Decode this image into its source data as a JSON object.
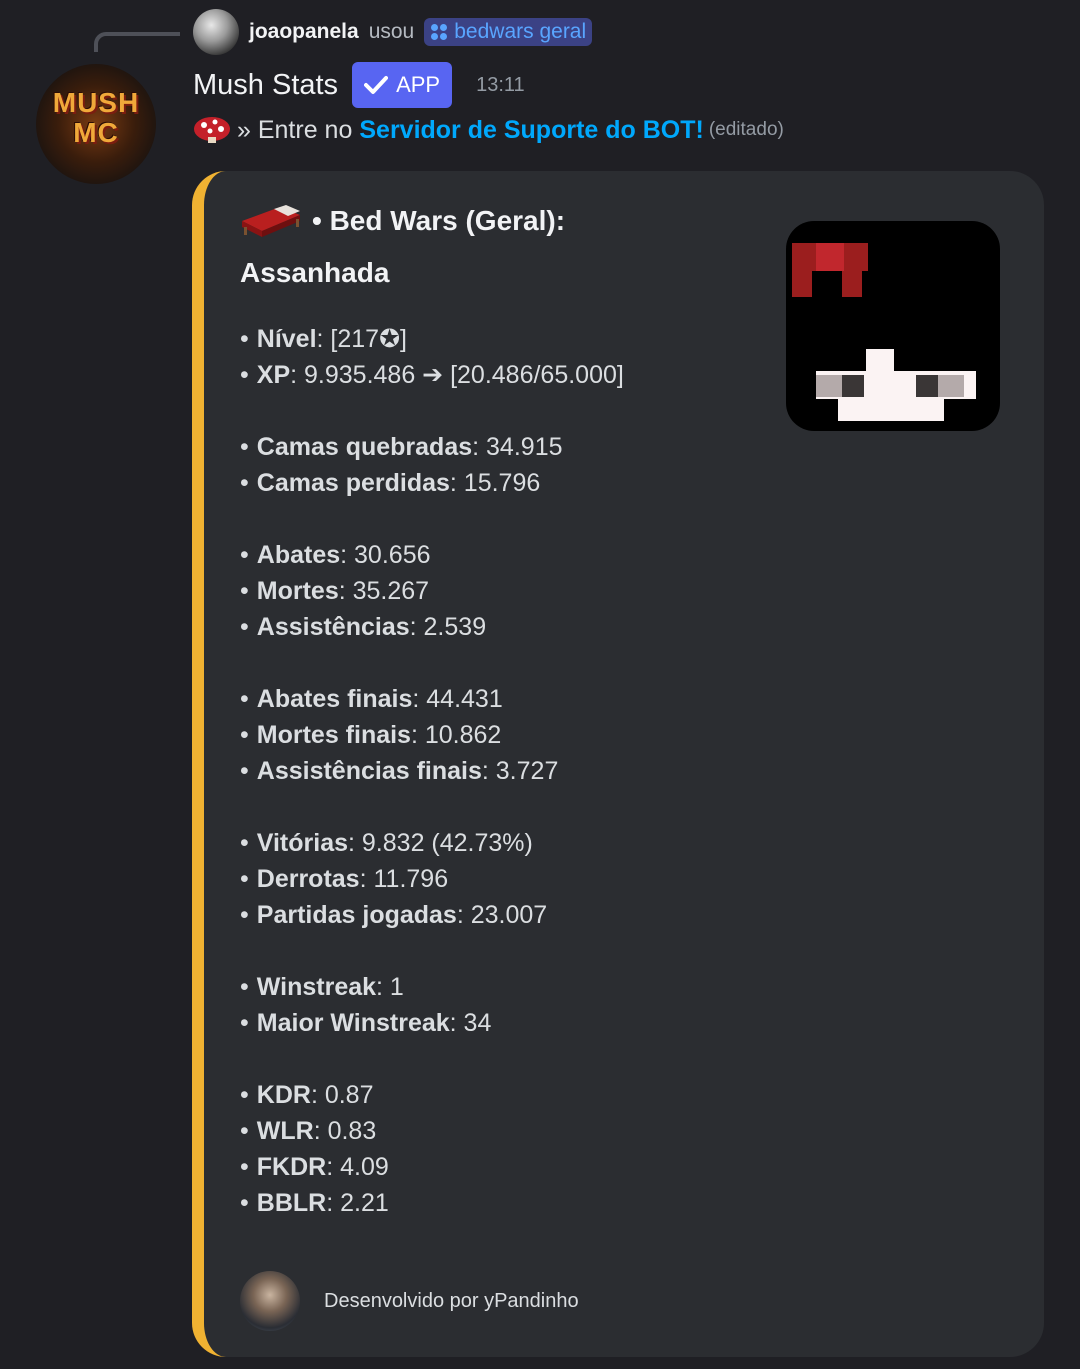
{
  "reply": {
    "username": "joaopanela",
    "action": "usou",
    "command": "bedwars geral"
  },
  "message": {
    "bot_name": "Mush Stats",
    "badge": "APP",
    "time": "13:11",
    "content_prefix": "» Entre no",
    "content_link": "Servidor de Suporte do BOT!",
    "edited": "(editado)"
  },
  "embed": {
    "accent_color": "#f0b232",
    "title": "• Bed Wars (Geral):",
    "subtitle": "Assanhada",
    "groups": [
      [
        {
          "label": "Nível",
          "value": ": [217✪]"
        },
        {
          "label": "XP",
          "value": ": 9.935.486 ➔ [20.486/65.000]"
        }
      ],
      [
        {
          "label": "Camas quebradas",
          "value": ": 34.915"
        },
        {
          "label": "Camas perdidas",
          "value": ": 15.796"
        }
      ],
      [
        {
          "label": "Abates",
          "value": ": 30.656"
        },
        {
          "label": "Mortes",
          "value": ": 35.267"
        },
        {
          "label": "Assistências",
          "value": ": 2.539"
        }
      ],
      [
        {
          "label": "Abates finais",
          "value": ": 44.431"
        },
        {
          "label": "Mortes finais",
          "value": ": 10.862"
        },
        {
          "label": "Assistências finais",
          "value": ": 3.727"
        }
      ],
      [
        {
          "label": "Vitórias",
          "value": ": 9.832 (42.73%)"
        },
        {
          "label": "Derrotas",
          "value": ": 11.796"
        },
        {
          "label": "Partidas jogadas",
          "value": ": 23.007"
        }
      ],
      [
        {
          "label": "Winstreak",
          "value": ": 1"
        },
        {
          "label": "Maior Winstreak",
          "value": ": 34"
        }
      ],
      [
        {
          "label": "KDR",
          "value": ": 0.87"
        },
        {
          "label": "WLR",
          "value": ": 0.83"
        },
        {
          "label": "FKDR",
          "value": ": 4.09"
        },
        {
          "label": "BBLR",
          "value": ": 2.21"
        }
      ]
    ],
    "footer": "Desenvolvido por yPandinho"
  },
  "icons": {
    "command": "slash-command-icon",
    "verified": "checkmark-icon",
    "mushroom": "mushroom-icon",
    "bed": "bed-icon"
  },
  "logo_text": "MUSH MC"
}
